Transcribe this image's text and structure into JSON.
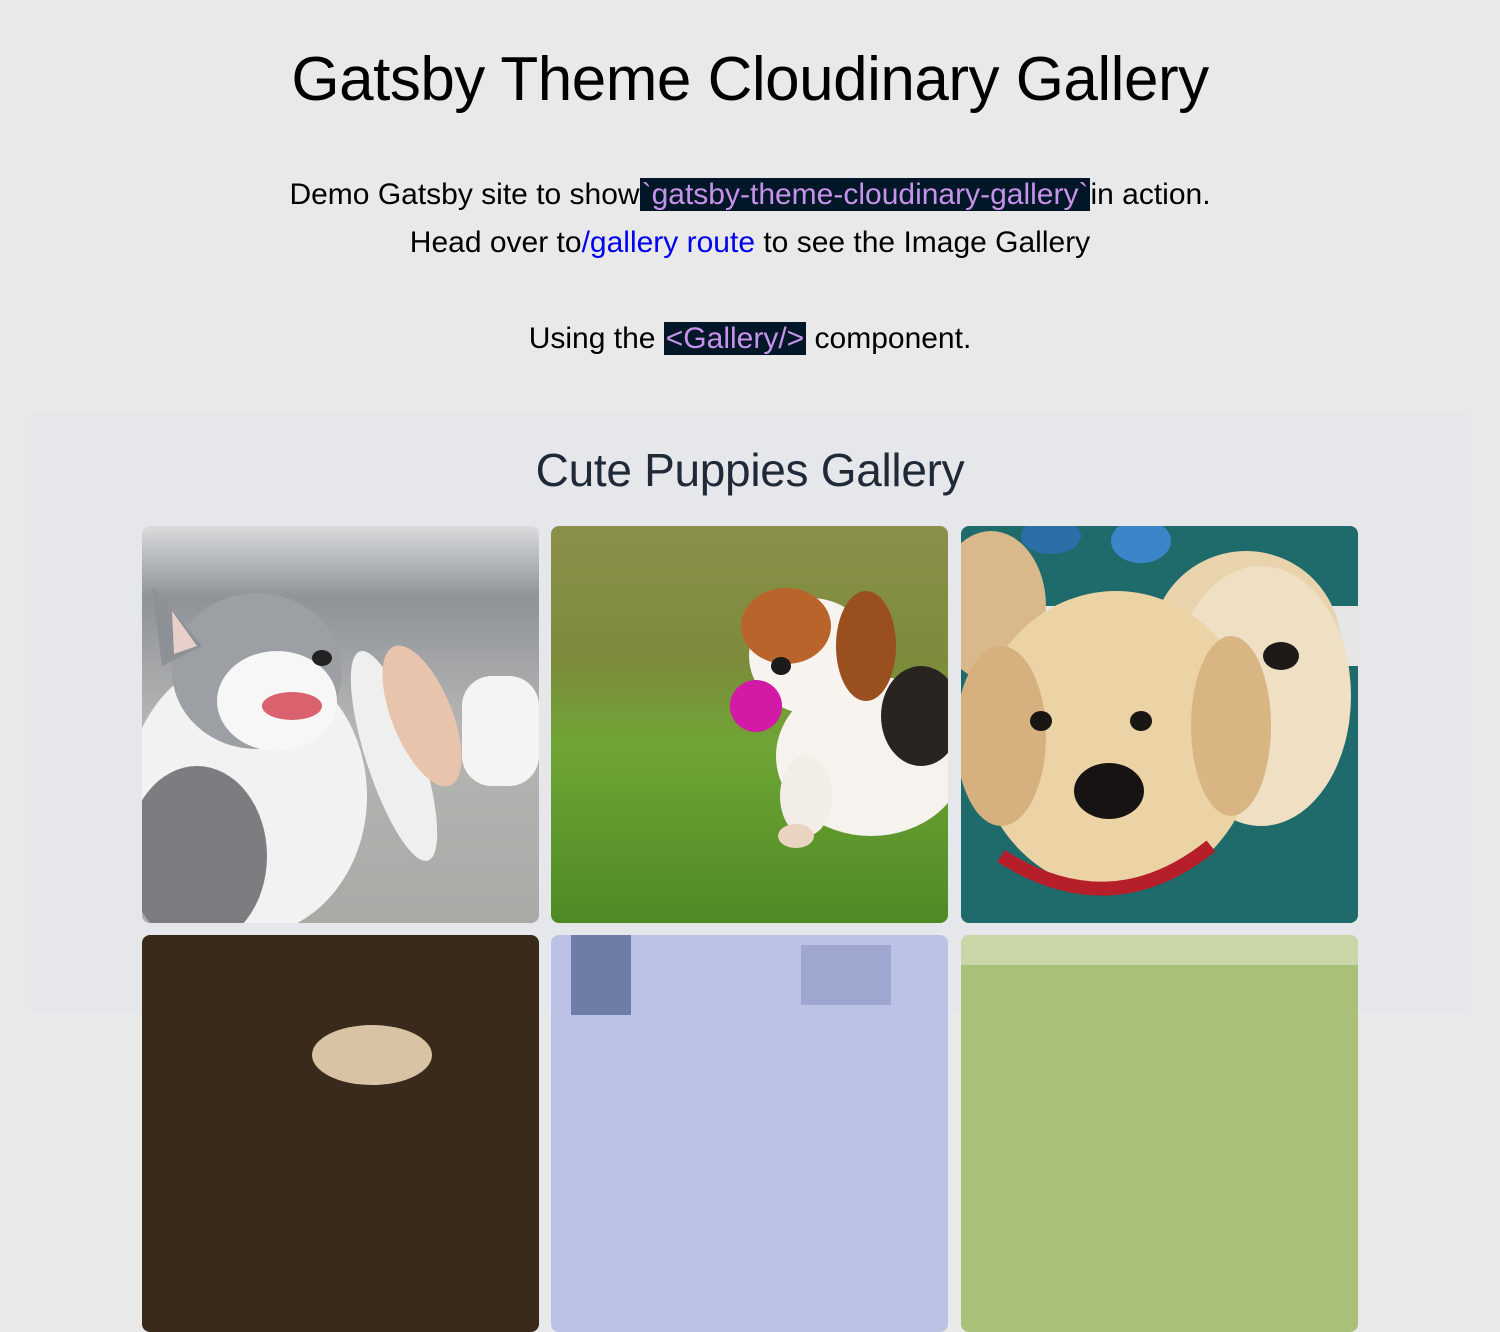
{
  "page": {
    "title": "Gatsby Theme Cloudinary Gallery",
    "intro": {
      "line1_before": "Demo Gatsby site to show",
      "line1_code": "`gatsby-theme-cloudinary-gallery`",
      "line1_after": "in action.",
      "line2_before": "Head over to",
      "line2_link": "/gallery route",
      "line2_after": " to see the Image Gallery",
      "line3_before": "Using the ",
      "line3_code": "<Gallery/>",
      "line3_after": " component."
    }
  },
  "gallery": {
    "title": "Cute Puppies Gallery",
    "images": [
      {
        "subject": "husky-puppy-high-five"
      },
      {
        "subject": "beagle-puppy-with-ball"
      },
      {
        "subject": "labrador-puppies"
      },
      {
        "subject": "puppy-photo-4"
      },
      {
        "subject": "puppy-photo-5"
      },
      {
        "subject": "puppy-photo-6"
      }
    ]
  },
  "colors": {
    "page_bg": "#e9e9e9",
    "panel_bg": "#e5e7eb",
    "code_bg": "#011627",
    "code_fg": "#c792ea",
    "link": "#0000ee",
    "gallery_title": "#1f2937"
  }
}
